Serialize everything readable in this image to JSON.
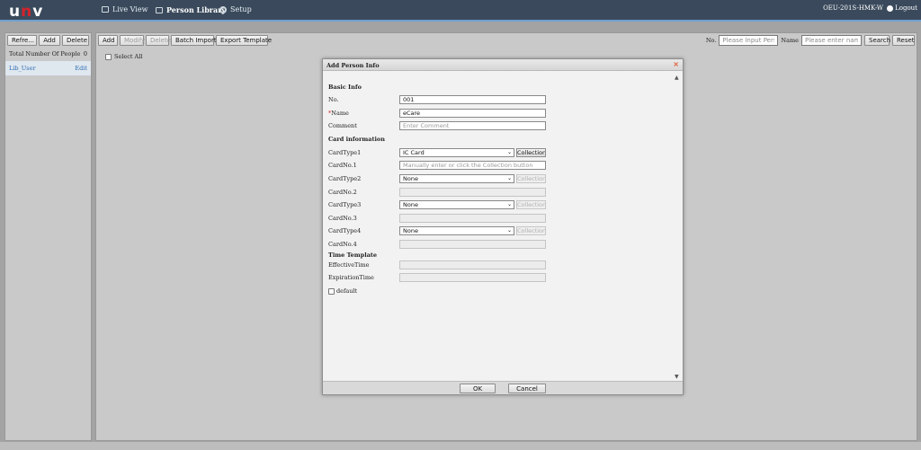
{
  "header": {
    "logo": "unv",
    "nav": [
      {
        "label": "Live View"
      },
      {
        "label": "Person Library"
      },
      {
        "label": "Setup"
      }
    ],
    "device": "OEU-201S-HMK-W",
    "logout": "Logout"
  },
  "sidebar": {
    "refresh": "Refre...",
    "add": "Add",
    "delete": "Delete",
    "total_label": "Total Number Of People",
    "total_value": "0",
    "lib_name": "Lib_User",
    "lib_edit": "Edit"
  },
  "toolbar": {
    "add": "Add",
    "modify": "Modify",
    "delete": "Delete",
    "batch_import": "Batch Import",
    "export_template": "Export Template"
  },
  "search": {
    "no_label": "No.",
    "no_placeholder": "Please Input Person",
    "name_label": "Name",
    "name_placeholder": "Please enter name",
    "search": "Search",
    "reset": "Reset"
  },
  "select_all": "Select All",
  "dialog": {
    "title": "Add Person Info",
    "close": "×",
    "basic_info": "Basic Info",
    "no_label": "No.",
    "no_value": "001",
    "name_required": "*",
    "name_label": "Name",
    "name_value": "eCare",
    "comment_label": "Comment",
    "comment_placeholder": "Enter Comment",
    "card_info": "Card information",
    "cardtype1_label": "CardType1",
    "cardtype1_value": "IC Card",
    "cardno1_label": "CardNo.1",
    "cardno1_placeholder": "Manually enter or click the Collection button",
    "cardtype2_label": "CardType2",
    "cardtype2_value": "None",
    "cardno2_label": "CardNo.2",
    "cardtype3_label": "CardType3",
    "cardtype3_value": "None",
    "cardno3_label": "CardNo.3",
    "cardtype4_label": "CardType4",
    "cardtype4_value": "None",
    "cardno4_label": "CardNo.4",
    "collection": "Collection",
    "time_template": "Time Template",
    "effective_label": "EffectiveTime",
    "expiration_label": "ExpirationTime",
    "default_label": "default",
    "ok": "OK",
    "cancel": "Cancel"
  }
}
